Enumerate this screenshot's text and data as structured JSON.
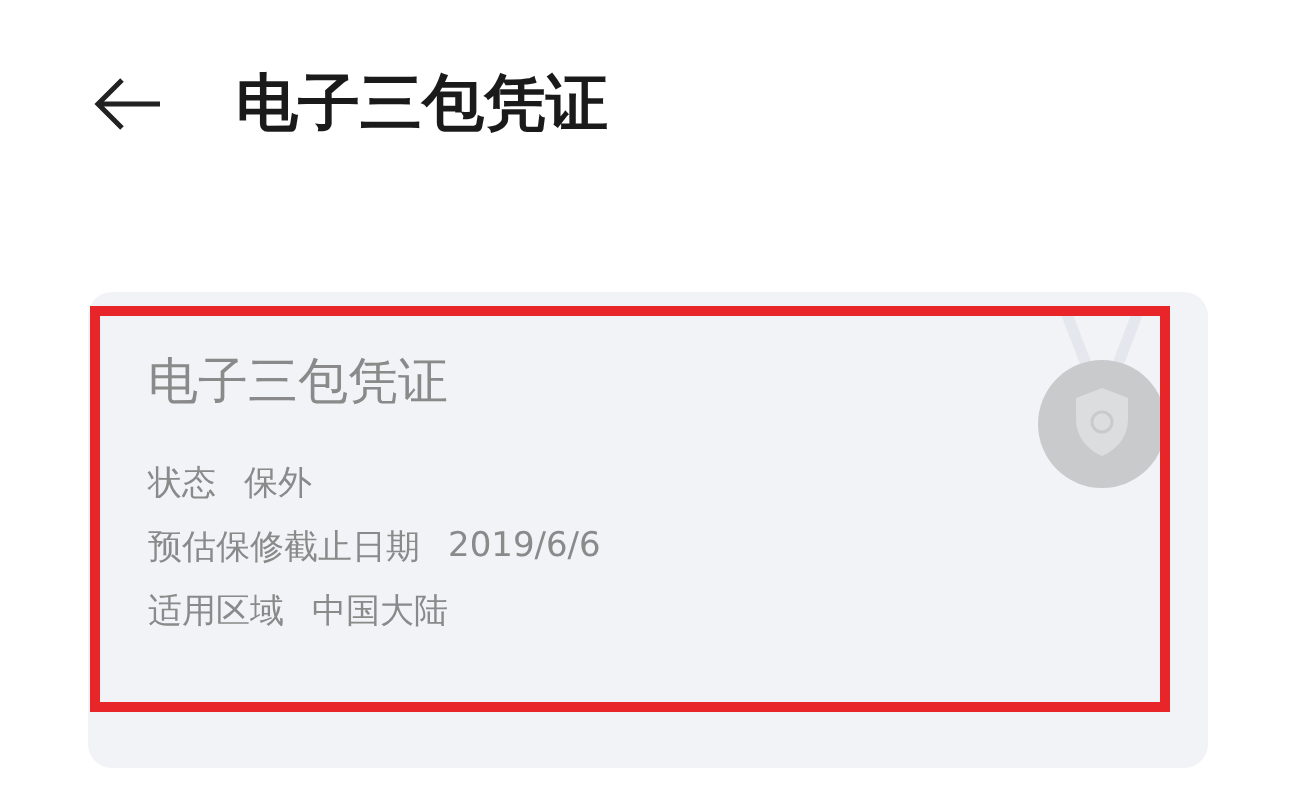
{
  "header": {
    "title": "电子三包凭证"
  },
  "card": {
    "title": "电子三包凭证",
    "highlighted": true,
    "fields": [
      {
        "label": "状态",
        "value": "保外"
      },
      {
        "label": "预估保修截止日期",
        "value": "2019/6/6"
      },
      {
        "label": "适用区域",
        "value": "中国大陆"
      }
    ]
  }
}
